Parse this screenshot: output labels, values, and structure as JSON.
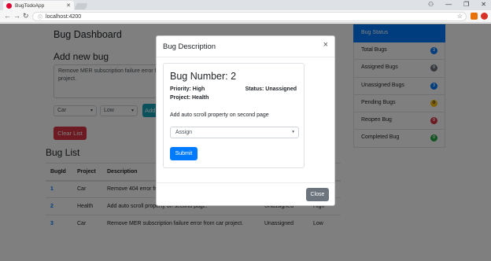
{
  "browser": {
    "tab_title": "BugTodoApp",
    "url": "localhost:4200",
    "url_info_icon": "info-icon",
    "nav": {
      "back": "←",
      "forward": "→",
      "reload": "↻"
    },
    "window_controls": {
      "user": "⚇",
      "minimize": "—",
      "restore": "❐",
      "close": "✕"
    }
  },
  "page": {
    "dashboard_title": "Bug Dashboard",
    "add_title": "Add new bug",
    "description_value": "Remove MER subscription  failure error from car project.",
    "project_select": "Car",
    "priority_select": "Low",
    "add_button": "Add",
    "clear_button": "Clear List",
    "list_title": "Bug List"
  },
  "table": {
    "headers": [
      "BugId",
      "Project",
      "Description",
      "",
      ""
    ],
    "rows": [
      {
        "id": "1",
        "project": "Car",
        "description": "Remove 404 error from car project.",
        "status": "",
        "priority": ""
      },
      {
        "id": "2",
        "project": "Health",
        "description": "Add auto scroll property on second page.",
        "status": "Unassigned",
        "priority": "High"
      },
      {
        "id": "3",
        "project": "Car",
        "description": "Remove MER subscription failure error from car project.",
        "status": "Unassigned",
        "priority": "Low"
      }
    ]
  },
  "sidebar": {
    "title": "Bug Status",
    "items": [
      {
        "label": "Total Bugs",
        "count": "3",
        "color": "#007bff"
      },
      {
        "label": "Assigned Bugs",
        "count": "0",
        "color": "#6c757d"
      },
      {
        "label": "Unassigned Bugs",
        "count": "3",
        "color": "#007bff"
      },
      {
        "label": "Pending Bugs",
        "count": "0",
        "color": "#ffc107"
      },
      {
        "label": "Reopen Bug",
        "count": "0",
        "color": "#dc3545"
      },
      {
        "label": "Completed Bug",
        "count": "0",
        "color": "#28a745"
      }
    ]
  },
  "modal": {
    "title": "Bug Description",
    "close_x": "×",
    "bug_number": "Bug Number: 2",
    "priority": "Priority: High",
    "status": "Status: Unassigned",
    "project": "Project: Health",
    "description": "Add auto scroll property on second page",
    "assign_select": "Assign",
    "submit_button": "Submit",
    "close_button": "Close"
  },
  "colors": {
    "primary": "#007bff",
    "danger": "#dc3545",
    "info": "#17a2b8",
    "secondary": "#6c757d"
  }
}
